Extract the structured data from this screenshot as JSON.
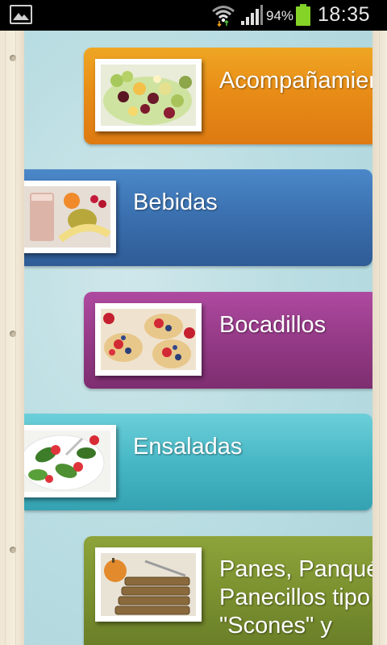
{
  "status_bar": {
    "battery_percent": "94%",
    "time": "18:35",
    "icons": [
      "gallery-notification-icon",
      "wifi-icon",
      "signal-icon",
      "battery-icon"
    ]
  },
  "categories": [
    {
      "label": "Acompañamientos",
      "color": "#e88d17",
      "image": "fruit-salad"
    },
    {
      "label": "Bebidas",
      "color": "#3a6fae",
      "image": "smoothie"
    },
    {
      "label": "Bocadillos",
      "color": "#953a87",
      "image": "fruit-tartlets"
    },
    {
      "label": "Ensaladas",
      "color": "#47b7c5",
      "image": "spinach-strawberry-salad"
    },
    {
      "label": "Panes, Panqués, Panecillos tipo \"Scones\" y",
      "color": "#7c9230",
      "image": "sliced-bread"
    }
  ]
}
